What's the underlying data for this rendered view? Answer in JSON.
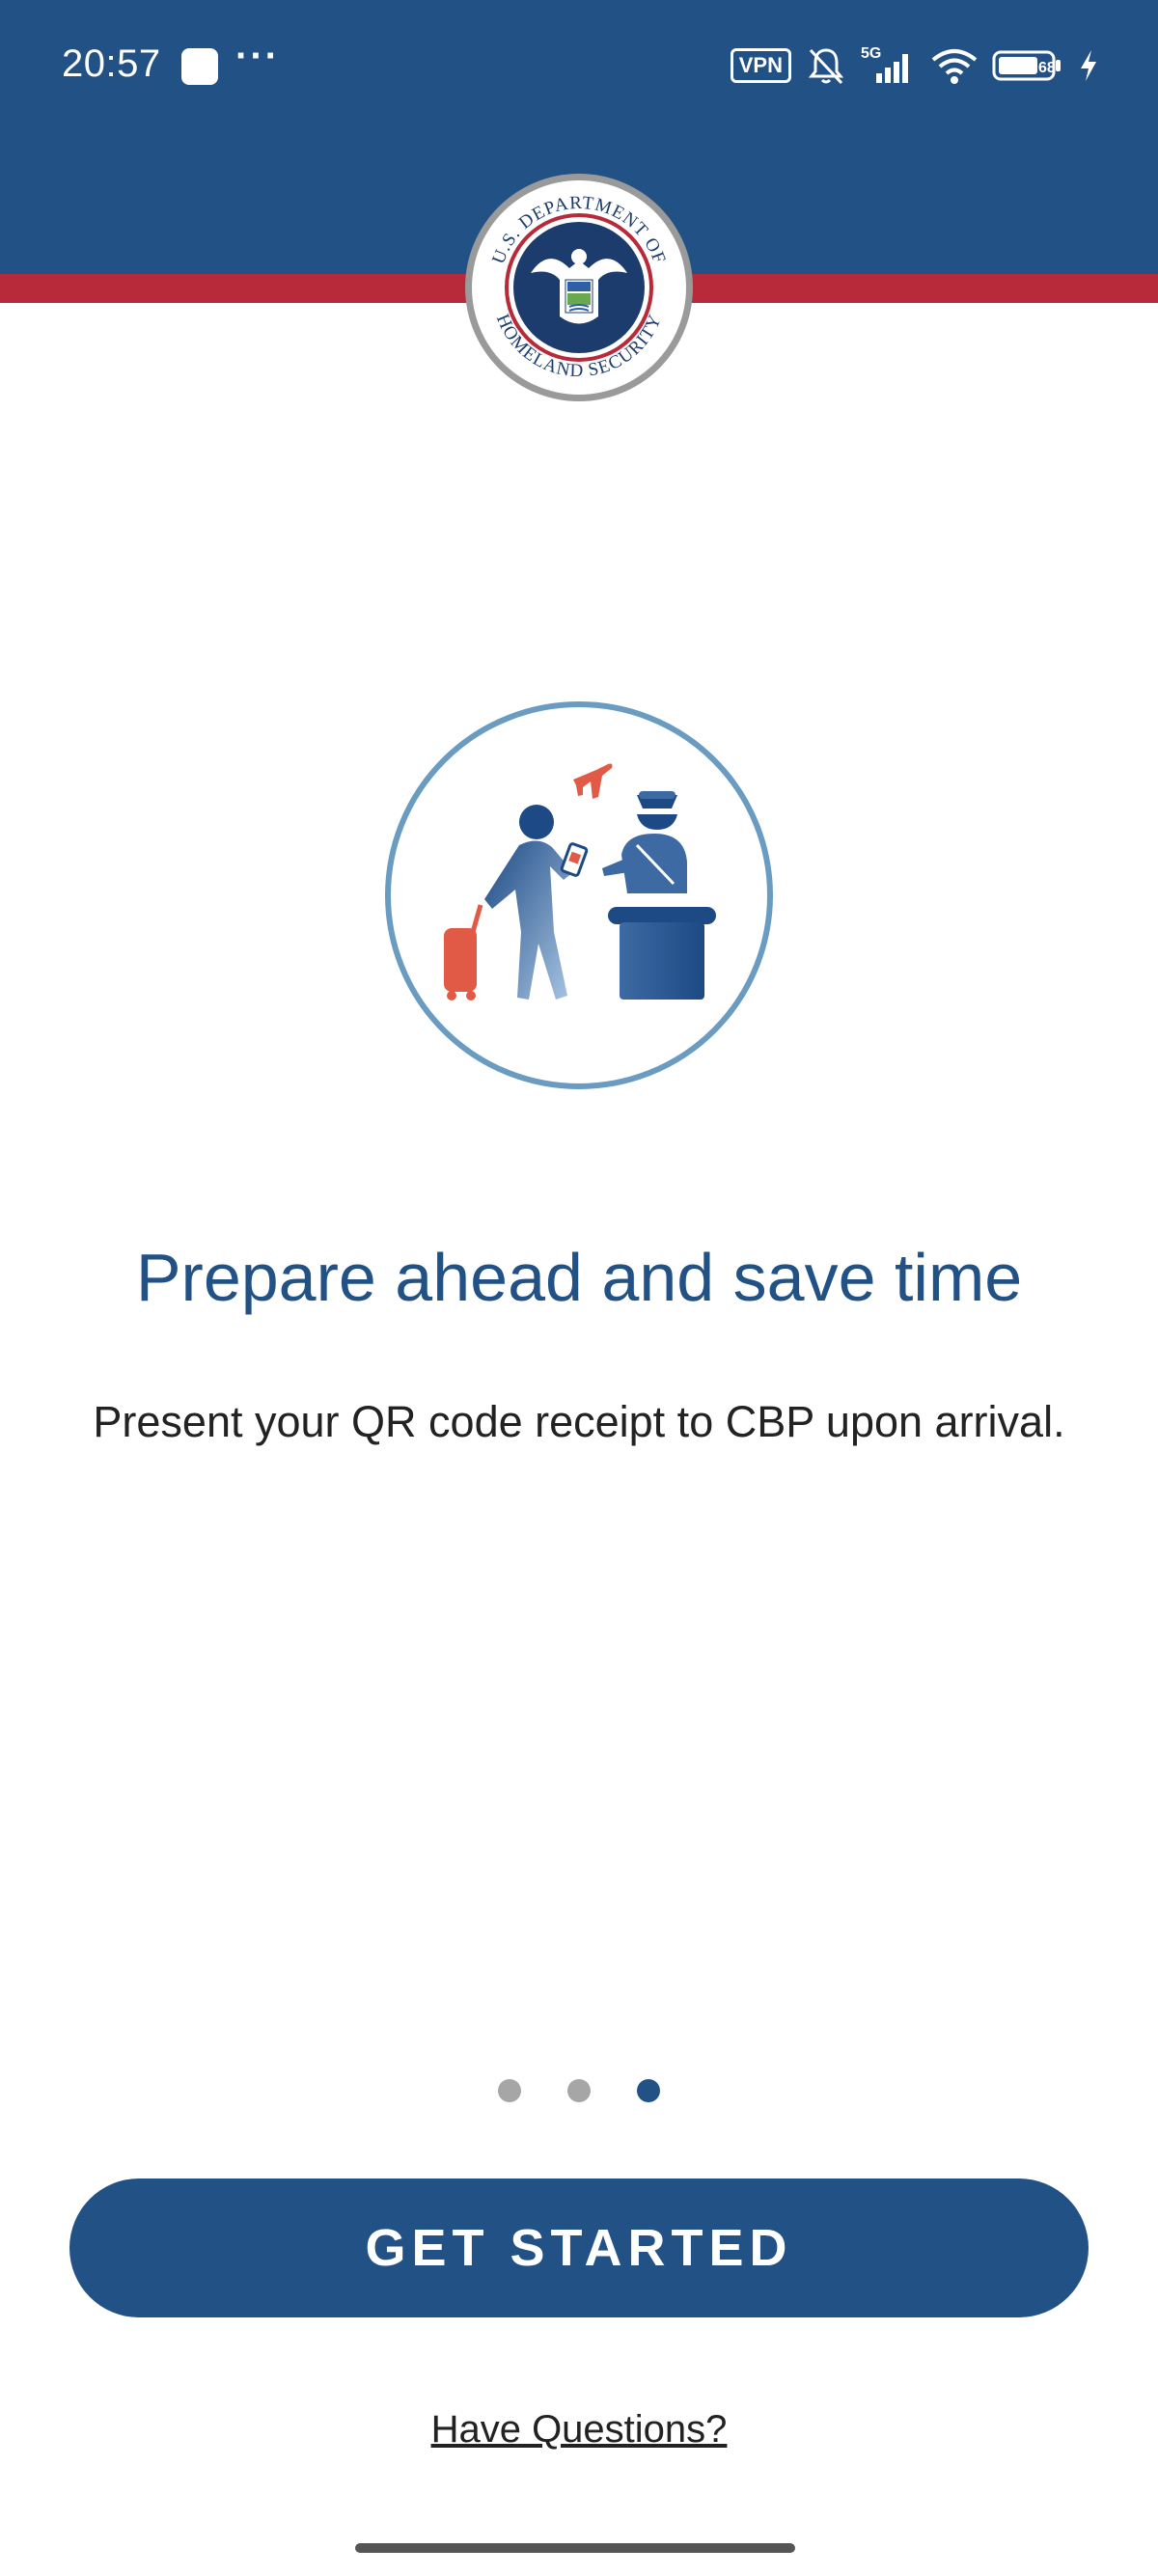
{
  "status_bar": {
    "time": "20:57",
    "more": "···",
    "vpn": "VPN",
    "network": "5G",
    "battery_level": "68",
    "icons": [
      "app-notification-icon",
      "vpn-icon",
      "mute-bell-icon",
      "signal-icon",
      "wifi-icon",
      "battery-icon",
      "charging-icon"
    ]
  },
  "header": {
    "seal_top_text": "U.S. DEPARTMENT OF",
    "seal_bottom_text": "HOMELAND SECURITY",
    "colors": {
      "band": "#225186",
      "stripe": "#b8293a"
    }
  },
  "onboarding": {
    "illustration": "traveler-presenting-phone-to-officer-icon",
    "headline": "Prepare ahead and save time",
    "body": "Present your QR code receipt to CBP upon arrival.",
    "pager": {
      "total": 3,
      "active_index": 2
    }
  },
  "actions": {
    "primary_label": "GET STARTED",
    "secondary_label": "Have Questions?"
  },
  "colors": {
    "accent": "#225186",
    "text": "#222222",
    "dot_inactive": "#a6a6a6"
  }
}
